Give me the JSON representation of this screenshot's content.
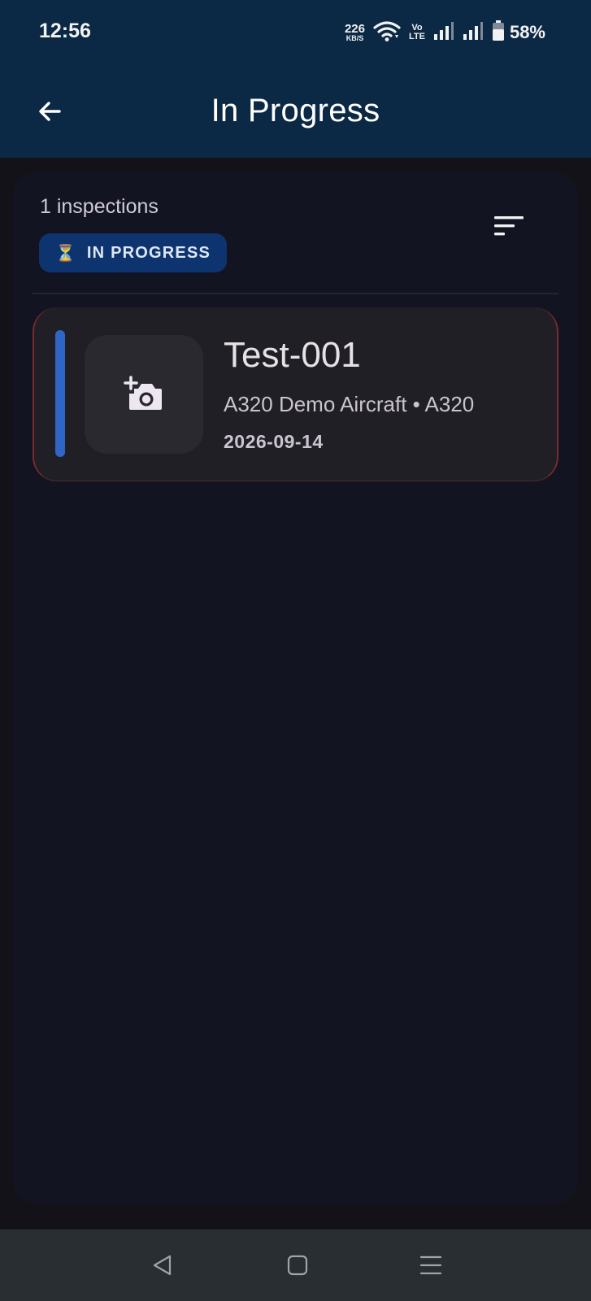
{
  "status_bar": {
    "time": "12:56",
    "net_speed_value": "226",
    "net_speed_unit": "KB/S",
    "volte_top": "Vo",
    "volte_bottom": "LTE",
    "battery_percent": "58%"
  },
  "app_bar": {
    "title": "In Progress",
    "back_icon": "arrow-back-icon"
  },
  "list": {
    "count_label": "1 inspections",
    "filter_chip": {
      "icon": "⏳",
      "label": "IN PROGRESS"
    },
    "sort_icon": "sort-icon",
    "items": [
      {
        "title": "Test-001",
        "subtitle": "A320 Demo Aircraft • A320",
        "date": "2026-09-14",
        "thumb_icon": "add-photo-icon"
      }
    ]
  },
  "colors": {
    "header": "#0b2944",
    "background": "#141219",
    "panel": "#121421",
    "card": "#211f26",
    "accent": "#2f66c6",
    "chip": "#0e3470",
    "nav_bar": "#292e33"
  }
}
